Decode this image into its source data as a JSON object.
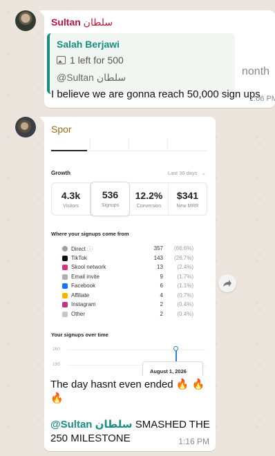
{
  "message1": {
    "sender_name": "Sultan",
    "sender_arabic": "سلطان",
    "quote": {
      "author": "Salah Berjawi",
      "line": "1 left for 500",
      "sub": "@Sultan سلطان",
      "overflow": "nonth"
    },
    "text": "I believe we are gonna reach 50,000 sign ups",
    "time": "1:06 PM"
  },
  "message2": {
    "sender_name": "Spor",
    "screenshot": {
      "growth_label": "Growth",
      "range_selector": "Last 30 days",
      "stats": [
        {
          "value": "4.3k",
          "label": "Visitors"
        },
        {
          "value": "536",
          "label": "Signups"
        },
        {
          "value": "12.2%",
          "label": "Conversion"
        },
        {
          "value": "$341",
          "label": "New MRR"
        }
      ],
      "sources_heading": "Where your signups come from",
      "sources": [
        {
          "name": "Direct",
          "count": "357",
          "pct": "(66.6%)",
          "icon": "globe-icon",
          "color": "#9e9e9e"
        },
        {
          "name": "TikTok",
          "count": "143",
          "pct": "(26.7%)",
          "icon": "tiktok-icon",
          "color": "#111111"
        },
        {
          "name": "Skool network",
          "count": "13",
          "pct": "(2.4%)",
          "icon": "skool-icon",
          "color": "#d63384"
        },
        {
          "name": "Email invite",
          "count": "9",
          "pct": "(1.7%)",
          "icon": "email-icon",
          "color": "#b0b0b0"
        },
        {
          "name": "Facebook",
          "count": "6",
          "pct": "(1.1%)",
          "icon": "facebook-icon",
          "color": "#1877f2"
        },
        {
          "name": "Affiliate",
          "count": "4",
          "pct": "(0.7%)",
          "icon": "affiliate-icon",
          "color": "#f2b705"
        },
        {
          "name": "Instagram",
          "count": "2",
          "pct": "(0.4%)",
          "icon": "instagram-icon",
          "color": "#c13584"
        },
        {
          "name": "Other",
          "count": "2",
          "pct": "(0.4%)",
          "icon": "more-icon",
          "color": "#c8c8c8"
        }
      ],
      "timeline_heading": "Your signups over time",
      "y_ticks": [
        "260",
        "195"
      ],
      "tooltip_date": "August 1, 2026"
    },
    "text": "The day hasnt even ended",
    "mention": "@Sultan سلطان",
    "mention_rest": "SMASHED THE 250 MILESTONE",
    "time": "1:16 PM"
  }
}
